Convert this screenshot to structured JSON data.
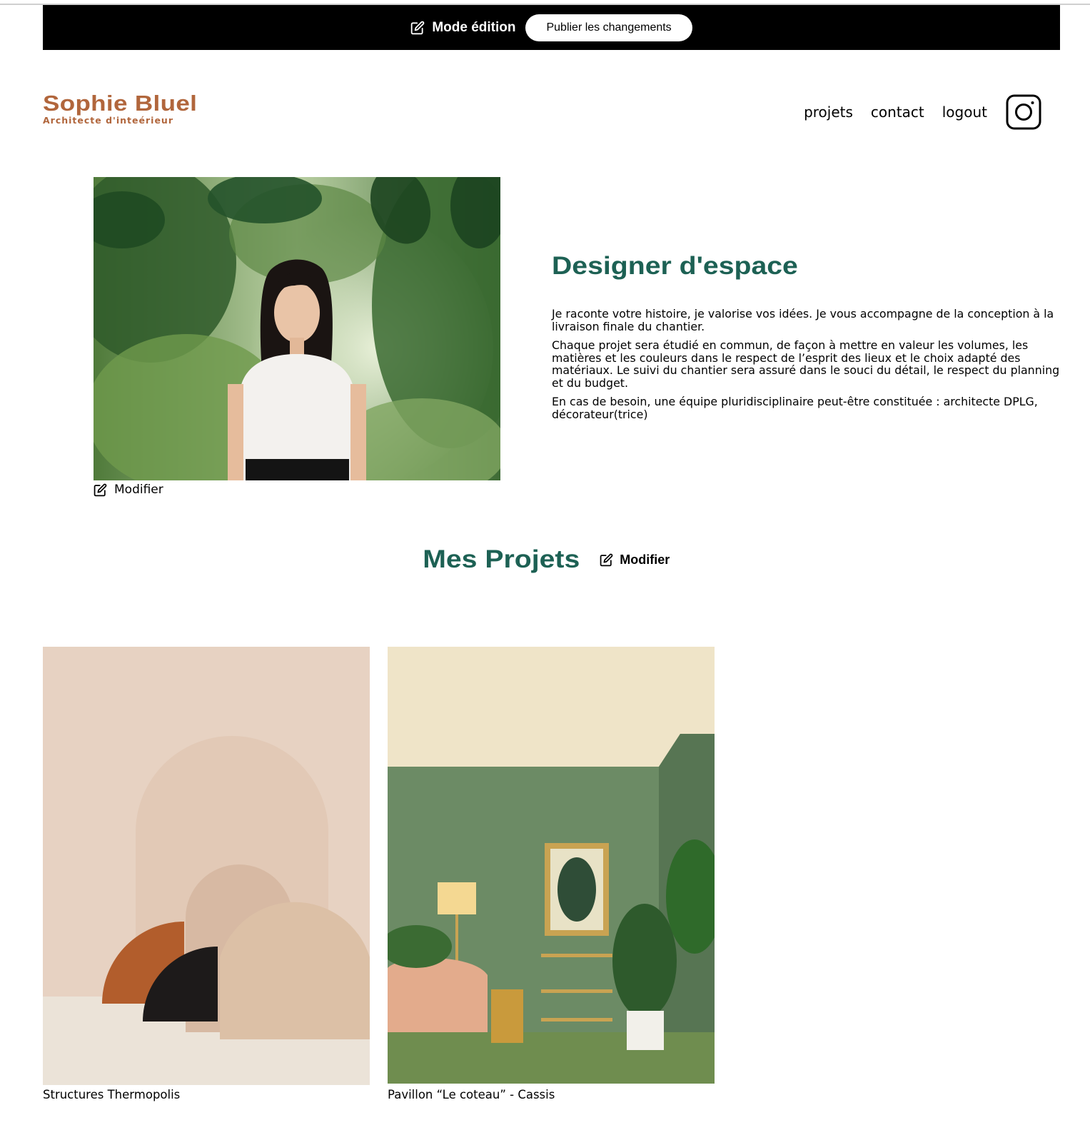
{
  "edit_bar": {
    "mode_label": "Mode édition",
    "publish_label": "Publier les changements"
  },
  "logo": {
    "name": "Sophie Bluel",
    "subtitle": "Architecte d'inteérieur"
  },
  "nav": {
    "items": [
      {
        "label": "projets"
      },
      {
        "label": "contact"
      },
      {
        "label": "logout"
      }
    ],
    "social_icon": "instagram-icon"
  },
  "intro": {
    "title": "Designer d'espace",
    "paragraphs": [
      "Je raconte votre histoire, je valorise vos idées. Je vous accompagne de la conception à la livraison finale du chantier.",
      "Chaque projet sera étudié en commun, de façon à mettre en valeur les volumes, les matières et les couleurs dans le respect de l’esprit des lieux et le choix adapté des matériaux. Le suivi du chantier sera assuré dans le souci du détail, le respect du planning et du budget.",
      "En cas de besoin, une équipe pluridisciplinaire peut-être constituée : architecte DPLG, décorateur(trice)"
    ],
    "modify_label": "Modifier"
  },
  "projects": {
    "title": "Mes Projets",
    "modify_label": "Modifier",
    "items": [
      {
        "caption": "Structures Thermopolis"
      },
      {
        "caption": "Pavillon “Le coteau” - Cassis"
      }
    ]
  },
  "colors": {
    "brand": "#b1663c",
    "accent": "#1d6154",
    "edit_bar": "#000000"
  }
}
